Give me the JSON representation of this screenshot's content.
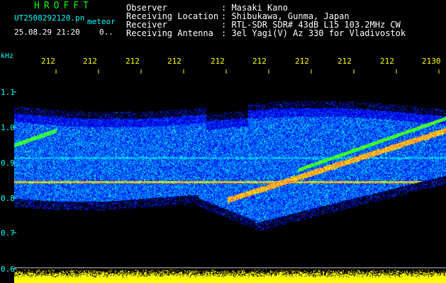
{
  "header": {
    "title": "HROFFT",
    "file_name": "UT2508292120.pn",
    "file_type": "meteor",
    "datetime": "25.08.29 21:20",
    "status": "0.."
  },
  "station_info": {
    "labels": [
      "Observer",
      "Receiving Location",
      "Receiver",
      "Receiving Antenna"
    ],
    "values": [
      ": Masaki Kano",
      ": Shibukawa, Gunma, Japan",
      ": RTL-SDR SDR# 43dB L15 103.2MHz CW",
      ": 3el Yagi(V) Az 330 for Vladivostok"
    ]
  },
  "axes": {
    "unit": "kHz",
    "time_ticks": [
      "212",
      "212",
      "212",
      "212",
      "212",
      "212",
      "212",
      "212",
      "212",
      "2130"
    ],
    "freq_ticks": [
      "1.1",
      "1.0",
      "0.9",
      "0.8",
      "0.7",
      "0.6"
    ]
  },
  "colors": {
    "background": "#000000",
    "text_primary": "#ffffff",
    "text_accent": "#00ffff",
    "axis": "#ffff00",
    "title": "#00ff00"
  }
}
